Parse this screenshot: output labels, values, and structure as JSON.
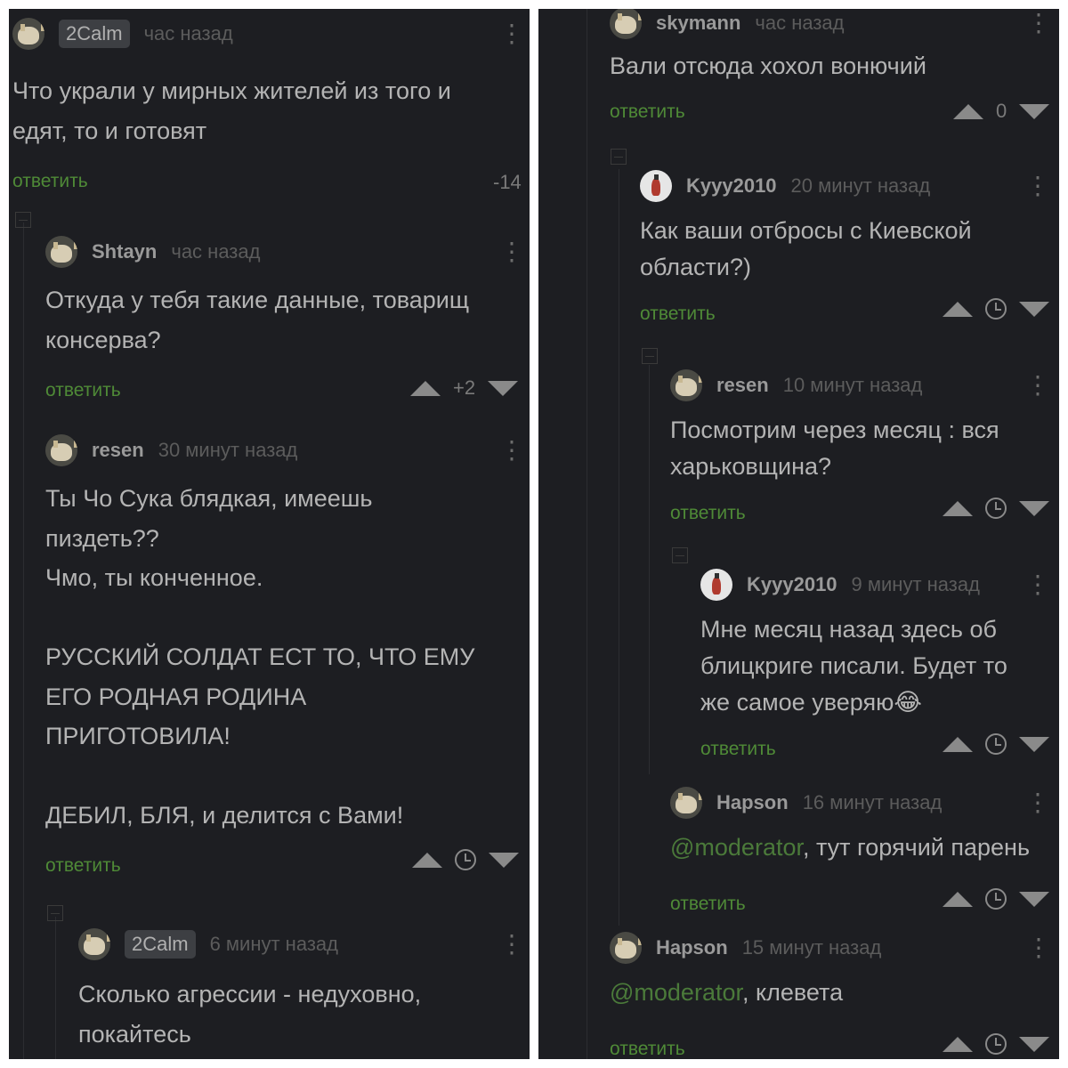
{
  "actions": {
    "reply": "ответить"
  },
  "left": {
    "c1": {
      "user": "2Calm",
      "time": "час назад",
      "text": "Что украли у мирных жителей из того и\nедят, то и готовят",
      "score": "-14"
    },
    "c2": {
      "user": "Shtayn",
      "time": "час назад",
      "text": "Откуда у тебя такие данные, товарищ\nконсерва?",
      "score": "+2"
    },
    "c3": {
      "user": "resen",
      "time": "30 минут назад",
      "text": "Ты Чо Сука блядкая, имеешь\nпиздеть??\nЧмо, ты конченное.\n\nРУССКИЙ СОЛДАТ ЕСТ ТО, ЧТО ЕМУ\nЕГО РОДНАЯ РОДИНА\nПРИГОТОВИЛА!\n\nДЕБИЛ, БЛЯ, и делится с Вами!"
    },
    "c4": {
      "user": "2Calm",
      "time": "6 минут назад",
      "text": "Сколько агрессии - недуховно,\nпокайтесь"
    }
  },
  "right": {
    "c1": {
      "user": "skymann",
      "time": "час назад",
      "text": "Вали отсюда хохол вонючий",
      "score": "0"
    },
    "c2": {
      "user": "Kyyy2010",
      "time": "20 минут назад",
      "text": "Как ваши отбросы с Киевской\nобласти?)"
    },
    "c3": {
      "user": "resen",
      "time": "10 минут назад",
      "text": "Посмотрим через месяц : вся\nхарьковщина?"
    },
    "c4": {
      "user": "Kyyy2010",
      "time": "9 минут назад",
      "text": "Мне месяц назад здесь об\nблицкриге писали. Будет то\nже самое уверяю😂"
    },
    "c5": {
      "user": "Hapson",
      "time": "16 минут назад",
      "mention": "@moderator",
      "text": ", тут горячий парень"
    },
    "c6": {
      "user": "Hapson",
      "time": "15 минут назад",
      "mention": "@moderator",
      "text": ", клевета"
    }
  }
}
